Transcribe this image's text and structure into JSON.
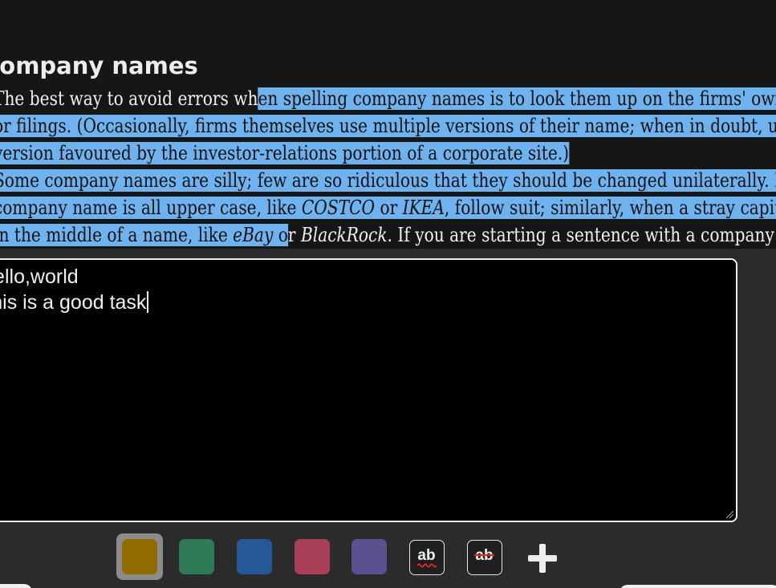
{
  "article": {
    "heading": "Company names",
    "lines": [
      {
        "plain": "The best way to avoid errors wh",
        "selected": "en spelling company names is to look them up on the firms' own websites",
        "tail": ""
      },
      {
        "plain": "",
        "selected": "or filings. (Occasionally, firms themselves use multiple versions of their name; when in doubt, use the",
        "tail": ""
      },
      {
        "plain": "",
        "selected": "version favoured by the investor-relations portion of a corporate site.)",
        "tail": ""
      },
      {
        "plain": "",
        "selected": "Some company names are silly; few are so ridiculous that they should be changed unilaterally. If a",
        "tail": ""
      },
      {
        "plain": "",
        "selected_parts": [
          "company name is all upper case, like ",
          "COSTCO",
          " or ",
          "IKEA",
          ", follow suit; similarly, when a stray capital appears"
        ]
      },
      {
        "plain_after": "r ",
        "selected_parts": [
          "in the middle of a name, like ",
          "eBay",
          " o"
        ],
        "tail_parts": [
          "BlackRock",
          ". If you are starting a sentence with a company name"
        ]
      }
    ]
  },
  "editor": {
    "lines": [
      "Hello,world",
      "This is a good task"
    ]
  },
  "toolbar": {
    "swatches": [
      {
        "name": "yellow",
        "color": "#8f6b00",
        "selected": true
      },
      {
        "name": "green",
        "color": "#2e7a57"
      },
      {
        "name": "blue",
        "color": "#245896"
      },
      {
        "name": "red",
        "color": "#a8405a"
      },
      {
        "name": "purple",
        "color": "#5a518f"
      }
    ],
    "spellcheck_label": "ab",
    "strikethrough_label": "ab"
  }
}
